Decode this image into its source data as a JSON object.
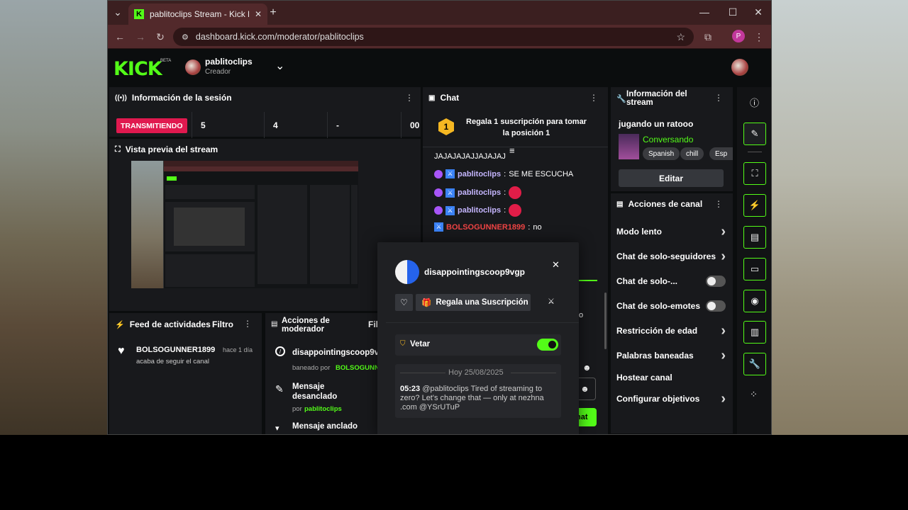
{
  "browser": {
    "tab_title": "pablitoclips Stream - Kick Dashl",
    "tab_favicon": "K",
    "url": "dashboard.kick.com/moderator/pablitoclips",
    "profile_initial": "P"
  },
  "header": {
    "logo": "KICK",
    "beta": "BETA",
    "channel_name": "pablitoclips",
    "channel_role": "Creador"
  },
  "session": {
    "title": "Información de la sesión",
    "status": "TRANSMITIENDO",
    "stats": [
      "5",
      "4",
      "-",
      "00"
    ]
  },
  "preview": {
    "title": "Vista previa del stream"
  },
  "feed": {
    "title": "Feed de actividades",
    "filter": "Filtro",
    "item_user": "BOLSOGUNNER1899",
    "item_time": "hace 1 día",
    "item_text": "acaba de seguir el canal"
  },
  "modactions": {
    "title": "Acciones de moderador",
    "filter": "Filtro",
    "a1_user": "disappointingscoop9v",
    "a1_prefix": "baneado por",
    "a1_by": "BOLSOGUNNER",
    "a2_title": "Mensaje desanclado",
    "a2_prefix": "por",
    "a2_by": "pablitoclips",
    "a3_title": "Mensaje anclado"
  },
  "chat": {
    "title": "Chat",
    "gift_rank": "1",
    "gift_text": "Regala 1 suscripción para tomar la posición 1",
    "top_msg": "JAJAJAJAJJAJAJAJ",
    "messages": [
      {
        "user": "pablitoclips",
        "text": "SE ME ESCUCHA"
      },
      {
        "user": "pablitoclips",
        "text": ""
      },
      {
        "user": "pablitoclips",
        "text": ""
      },
      {
        "user": "BOLSOGUNNER1899",
        "text": "no"
      }
    ],
    "send_label": "hat",
    "partial_o": "o"
  },
  "stream_info": {
    "title": "Información del stream",
    "stream_title": "jugando un ratooo",
    "category": "Conversando",
    "tags": [
      "Spanish",
      "chill",
      "Esp"
    ],
    "edit_label": "Editar"
  },
  "channel_actions": {
    "title": "Acciones de canal",
    "items": [
      {
        "label": "Modo lento",
        "control": "chevron"
      },
      {
        "label": "Chat de solo-seguidores",
        "control": "chevron"
      },
      {
        "label": "Chat de solo-...",
        "control": "toggle-off"
      },
      {
        "label": "Chat de solo-emotes",
        "control": "toggle-off"
      },
      {
        "label": "Restricción de edad",
        "control": "chevron"
      },
      {
        "label": "Palabras baneadas",
        "control": "chevron"
      },
      {
        "label": "Hostear canal",
        "control": "none"
      },
      {
        "label": "Configurar objetivos",
        "control": "chevron"
      }
    ]
  },
  "popup": {
    "username": "disappointingscoop9vgp",
    "gift_label": "Regala una Suscripción",
    "veto_label": "Vetar",
    "veto_on": true,
    "date_label": "Hoy 25/08/2025",
    "msg_time": "05:23",
    "msg_text": "@pablitoclips Tired of streaming to zero? Let's change that — only at nezhna .com @YSrUTuP"
  },
  "colors": {
    "kick_green": "#53fc18",
    "live_red": "#e0194f",
    "panel_bg": "#18191c",
    "page_bg": "#0b0d0e"
  }
}
